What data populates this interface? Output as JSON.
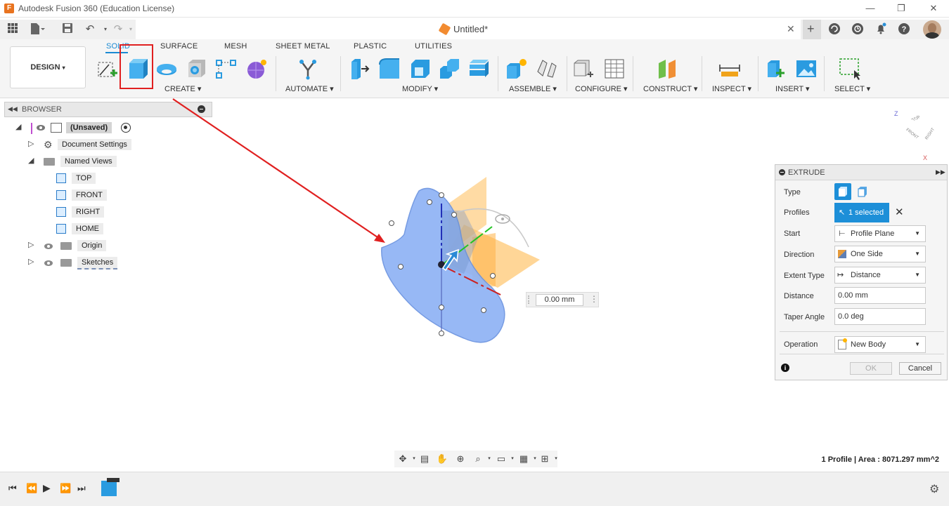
{
  "app": {
    "title": "Autodesk Fusion 360 (Education License)",
    "document_title": "Untitled*",
    "accent_color": "#0696d7",
    "highlight_color": "#e02020"
  },
  "ribbon": {
    "workspace": "DESIGN",
    "tabs": [
      "SOLID",
      "SURFACE",
      "MESH",
      "SHEET METAL",
      "PLASTIC",
      "UTILITIES"
    ],
    "active_tab": "SOLID",
    "groups": [
      "CREATE ▾",
      "AUTOMATE ▾",
      "MODIFY ▾",
      "ASSEMBLE ▾",
      "CONFIGURE ▾",
      "CONSTRUCT ▾",
      "INSPECT ▾",
      "INSERT ▾",
      "SELECT ▾"
    ]
  },
  "browser": {
    "header": "BROWSER",
    "items": [
      {
        "label": "(Unsaved)"
      },
      {
        "label": "Document Settings"
      },
      {
        "label": "Named Views"
      },
      {
        "label": "TOP"
      },
      {
        "label": "FRONT"
      },
      {
        "label": "RIGHT"
      },
      {
        "label": "HOME"
      },
      {
        "label": "Origin"
      },
      {
        "label": "Sketches"
      }
    ]
  },
  "viewport": {
    "distance_input": "0.00 mm",
    "viewcube_faces": [
      "TOP",
      "FRONT",
      "RIGHT"
    ],
    "axes": [
      "Z",
      "X"
    ]
  },
  "extrude": {
    "title": "EXTRUDE",
    "type_label": "Type",
    "profiles_label": "Profiles",
    "profiles_value": "1 selected",
    "start_label": "Start",
    "start_value": "Profile Plane",
    "direction_label": "Direction",
    "direction_value": "One Side",
    "extent_label": "Extent Type",
    "extent_value": "Distance",
    "distance_label": "Distance",
    "distance_value": "0.00 mm",
    "taper_label": "Taper Angle",
    "taper_value": "0.0 deg",
    "operation_label": "Operation",
    "operation_value": "New Body",
    "ok_label": "OK",
    "cancel_label": "Cancel"
  },
  "status": {
    "text": "1 Profile | Area : 8071.297 mm^2"
  }
}
